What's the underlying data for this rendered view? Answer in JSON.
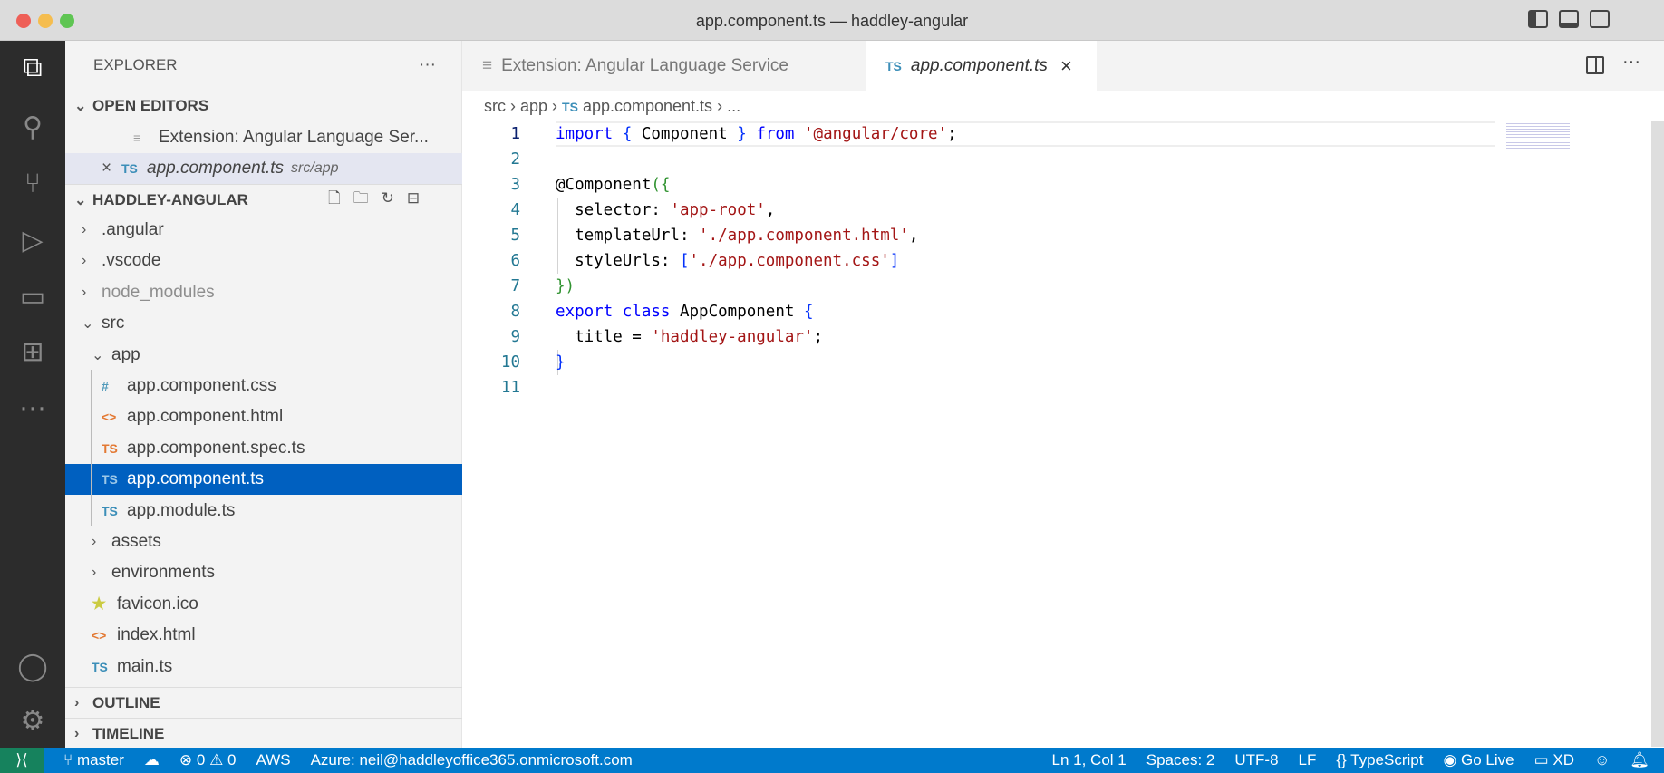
{
  "window": {
    "title": "app.component.ts — haddley-angular"
  },
  "sidebar": {
    "title": "EXPLORER",
    "more": "···",
    "open_editors": {
      "label": "OPEN EDITORS",
      "items": [
        {
          "label": "Extension: Angular Language Ser...",
          "icon": "preview-icon"
        },
        {
          "label": "app.component.ts",
          "path": "src/app",
          "icon": "TS",
          "close": "×"
        }
      ]
    },
    "project": {
      "label": "HADDLEY-ANGULAR"
    },
    "tree": [
      {
        "label": ".angular",
        "type": "folder",
        "depth": 0
      },
      {
        "label": ".vscode",
        "type": "folder",
        "depth": 0
      },
      {
        "label": "node_modules",
        "type": "folder",
        "depth": 0,
        "dim": true
      },
      {
        "label": "src",
        "type": "folder-open",
        "depth": 0
      },
      {
        "label": "app",
        "type": "folder-open",
        "depth": 1
      },
      {
        "label": "app.component.css",
        "type": "css",
        "icon": "#",
        "depth": 2
      },
      {
        "label": "app.component.html",
        "type": "html",
        "icon": "<>",
        "depth": 2
      },
      {
        "label": "app.component.spec.ts",
        "type": "html",
        "icon": "TS",
        "depth": 2
      },
      {
        "label": "app.component.ts",
        "type": "ts",
        "icon": "TS",
        "depth": 2,
        "selected": true
      },
      {
        "label": "app.module.ts",
        "type": "ts",
        "icon": "TS",
        "depth": 2
      },
      {
        "label": "assets",
        "type": "folder",
        "depth": 1
      },
      {
        "label": "environments",
        "type": "folder",
        "depth": 1
      },
      {
        "label": "favicon.ico",
        "type": "star",
        "icon": "★",
        "depth": 1
      },
      {
        "label": "index.html",
        "type": "html",
        "icon": "<>",
        "depth": 1
      },
      {
        "label": "main.ts",
        "type": "ts",
        "icon": "TS",
        "depth": 1
      }
    ],
    "outline": "OUTLINE",
    "timeline": "TIMELINE"
  },
  "tabs": [
    {
      "label": "Extension: Angular Language Service"
    },
    {
      "label": "app.component.ts",
      "icon": "TS",
      "close": "×"
    }
  ],
  "breadcrumb": {
    "parts": [
      "src",
      "app",
      "app.component.ts",
      "..."
    ],
    "icon": "TS"
  },
  "code": {
    "lines": [
      "1",
      "2",
      "3",
      "4",
      "5",
      "6",
      "7",
      "8",
      "9",
      "10",
      "11"
    ]
  },
  "status": {
    "branch": "master",
    "errors": "0",
    "warnings": "0",
    "aws": "AWS",
    "azure": "Azure: neil@haddleyoffice365.onmicrosoft.com",
    "position": "Ln 1, Col 1",
    "spaces": "Spaces: 2",
    "encoding": "UTF-8",
    "eol": "LF",
    "language": "TypeScript",
    "golive": "Go Live",
    "xd": "XD"
  }
}
